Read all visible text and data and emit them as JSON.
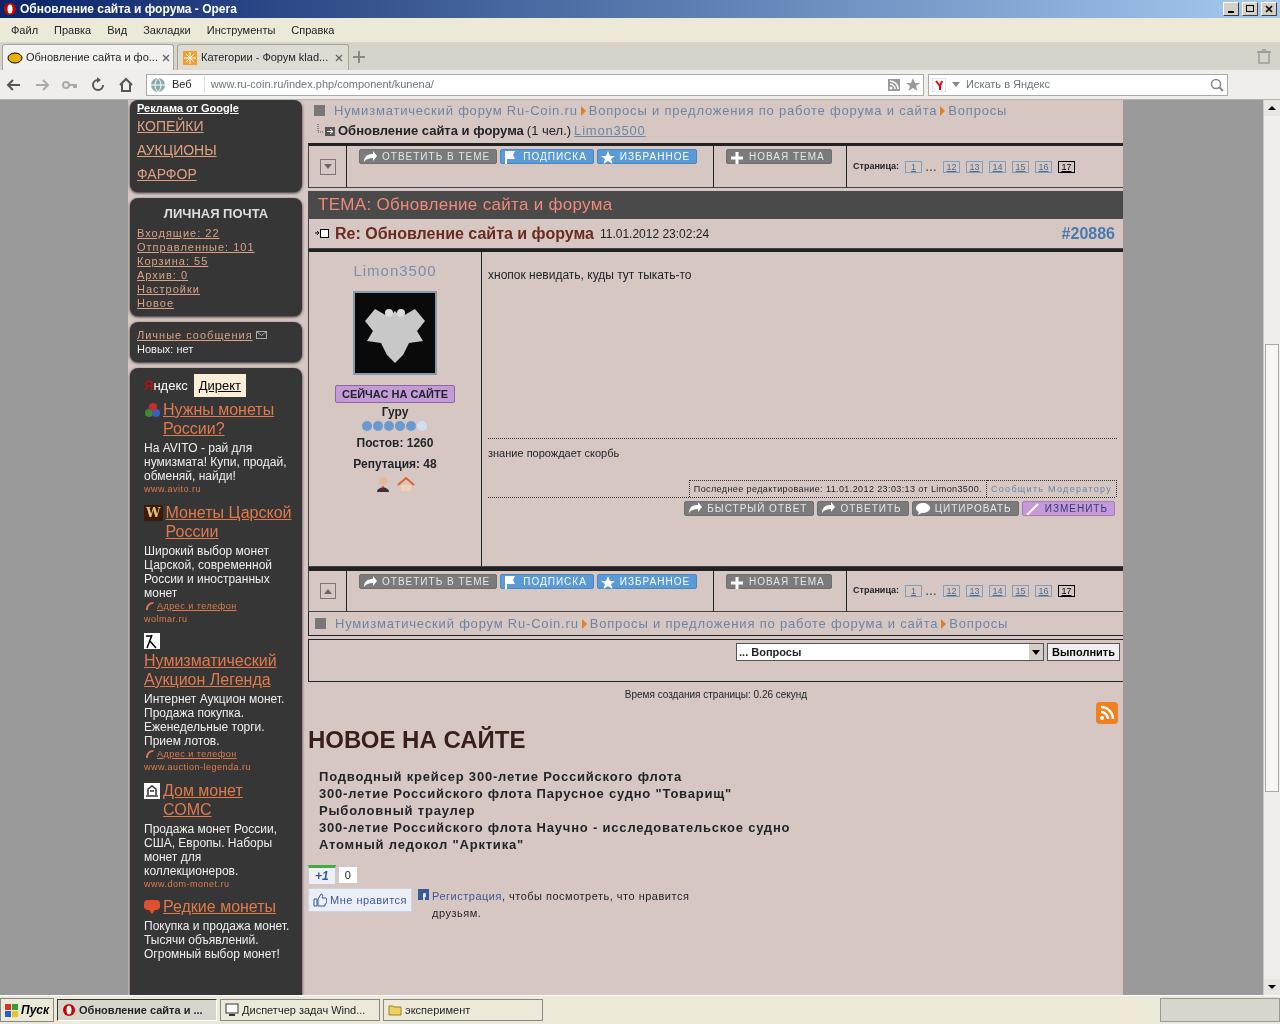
{
  "window": {
    "title": "Обновление сайта и форума - Opera"
  },
  "menu": [
    "Файл",
    "Правка",
    "Вид",
    "Закладки",
    "Инструменты",
    "Справка"
  ],
  "tabs": [
    {
      "label": "Обновление сайта и фо...",
      "selected": true
    },
    {
      "label": "Категории - Форум klad...",
      "selected": false
    }
  ],
  "address": {
    "mode": "Веб",
    "url": "www.ru-coin.ru/index.php/component/kunena/",
    "search_placeholder": "Искать в Яндекс"
  },
  "sidebar": {
    "links": [
      "Реклама от Google",
      "КОПЕЙКИ",
      "АУКЦИОНЫ",
      "ФАРФОР"
    ],
    "mail": {
      "title": "ЛИЧНАЯ ПОЧТА",
      "links": [
        "Входящие: 22",
        "Отправленные: 101",
        "Корзина: 55",
        "Архив: 0",
        "Настройки",
        "Новое"
      ]
    },
    "pm": {
      "link": "Личные сообщения",
      "status": "Новых: нет"
    },
    "direct": {
      "brand": "Яндекс",
      "badge": "Директ",
      "ads": [
        {
          "kind": "balls",
          "title": "Нужны монеты России?",
          "text": "На AVITO - рай для нумизмата! Купи, продай, обменяй, найди!",
          "url": "www.avito.ru"
        },
        {
          "kind": "w",
          "logo_text": "W",
          "title": "Монеты Царской России",
          "text": "Широкий выбор монет Царской, современной России и иностранных монет",
          "contact": "Адрес и телефон",
          "url": "wolmar.ru"
        },
        {
          "kind": "lambda",
          "title": "Нумизматический Аукцион Легенда",
          "text": "Интернет Аукцион монет. Продажа покупка. Еженедельные торги. Прием лотов.",
          "contact": "Адрес и телефон",
          "url": "www.auction-legenda.ru"
        },
        {
          "kind": "emblem",
          "title": "Дом монет СОМС",
          "text": "Продажа монет России, США, Европы. Наборы монет для коллекционеров.",
          "url": "www.dom-monet.ru"
        },
        {
          "kind": "dmir",
          "title": "Редкие монеты",
          "text": "Покупка и продажа монет. Тысячи объявлений. Огромный выбор монет!"
        }
      ]
    }
  },
  "breadcrumb_top": [
    "Нумизматический форум Ru-Coin.ru",
    "Вопросы и предложения по работе форума и сайта",
    "Вопросы"
  ],
  "topic_line": {
    "title": "Обновление сайта и форума",
    "count": "(1 чел.)",
    "user": "Limon3500"
  },
  "toolbar_top": {
    "buttons": [
      {
        "label": "ОТВЕТИТЬ В ТЕМЕ",
        "kind": "reply"
      },
      {
        "label": "ПОДПИСКА",
        "kind": "subscribe"
      },
      {
        "label": "ИЗБРАННОЕ",
        "kind": "favorite"
      },
      {
        "label": "НОВАЯ ТЕМА",
        "kind": "new"
      }
    ],
    "pages_label": "Страница:",
    "pages": [
      {
        "label": "1",
        "selected": false
      },
      {
        "label": "…",
        "kind": "gap"
      },
      {
        "label": "12",
        "selected": false
      },
      {
        "label": "13",
        "selected": false
      },
      {
        "label": "14",
        "selected": false
      },
      {
        "label": "15",
        "selected": false
      },
      {
        "label": "16",
        "selected": false
      },
      {
        "label": "17",
        "selected": true
      }
    ]
  },
  "topic_header": "ТЕМА: Обновление сайта и форума",
  "post": {
    "title": "Re: Обновление сайта и форума",
    "date": "11.01.2012 23:02:24",
    "number": "#20886",
    "author": "Limon3500",
    "online": "СЕЙЧАС НА САЙТЕ",
    "rank": "Гуру",
    "stars": 5,
    "posts": "Постов: 1260",
    "reputation": "Репутация: 48",
    "message": "хнопок невидать, куды тут тыкать-то",
    "signature": "знание порождает скорбь",
    "edited": "Последнее редактирование: 11.01.2012 23:03:13 от Limon3500.",
    "report": "Сообщить Модератору",
    "actions": [
      {
        "label": "БЫСТРЫЙ ОТВЕТ",
        "kind": "reply"
      },
      {
        "label": "ОТВЕТИТЬ",
        "kind": "reply"
      },
      {
        "label": "ЦИТИРОВАТЬ",
        "kind": "quote"
      },
      {
        "label": "ИЗМЕНИТЬ",
        "kind": "edit"
      }
    ]
  },
  "toolbar_bottom": {
    "buttons": [
      {
        "label": "ОТВЕТИТЬ В ТЕМЕ",
        "kind": "reply"
      },
      {
        "label": "ПОДПИСКА",
        "kind": "subscribe"
      },
      {
        "label": "ИЗБРАННОЕ",
        "kind": "favorite"
      },
      {
        "label": "НОВАЯ ТЕМА",
        "kind": "new"
      }
    ],
    "pages_label": "Страница:",
    "pages": [
      {
        "label": "1",
        "selected": false
      },
      {
        "label": "…",
        "kind": "gap"
      },
      {
        "label": "12",
        "selected": false
      },
      {
        "label": "13",
        "selected": false
      },
      {
        "label": "14",
        "selected": false
      },
      {
        "label": "15",
        "selected": false
      },
      {
        "label": "16",
        "selected": false
      },
      {
        "label": "17",
        "selected": true
      }
    ]
  },
  "breadcrumb_bottom": [
    "Нумизматический форум Ru-Coin.ru",
    "Вопросы и предложения по работе форума и сайта",
    "Вопросы"
  ],
  "jump": {
    "value": "... Вопросы",
    "button": "Выполнить"
  },
  "page_time": "Время создания страницы: 0.26 секунд",
  "news": {
    "title": "НОВОЕ НА САЙТЕ",
    "links": [
      "Подводный крейсер 300-летие Российского флота",
      "300-летие Российского флота Парусное судно \"Товарищ\"",
      "Рыболовный траулер",
      "300-летие Российского флота Научно - исследовательское судно",
      "Атомный ледокол \"Арктика\""
    ]
  },
  "social": {
    "plus": "+1",
    "plus_count": "0",
    "like": "Мне нравится",
    "fb_link": "Регистрация",
    "fb_text": ", чтобы посмотреть, что нравится друзьям."
  },
  "taskbar": {
    "start": "Пуск",
    "items": [
      {
        "label": "Обновление сайта и ...",
        "kind": "opera",
        "selected": true
      },
      {
        "label": "Диспетчер задач Wind...",
        "kind": "monitor",
        "selected": false
      },
      {
        "label": "эксперимент",
        "kind": "folder",
        "selected": false
      }
    ]
  }
}
